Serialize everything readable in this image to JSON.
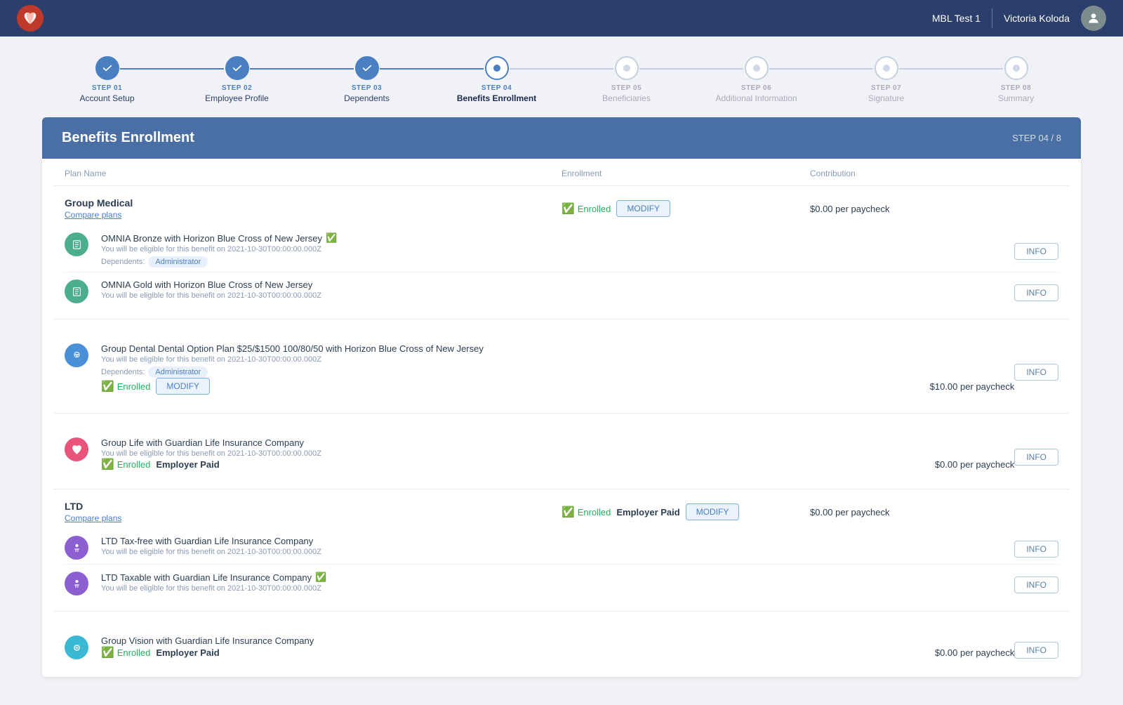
{
  "app": {
    "logo_emoji": "♥",
    "org": "MBL Test 1",
    "user": "Victoria Koloda"
  },
  "stepper": {
    "steps": [
      {
        "num": "STEP 01",
        "name": "Account Setup",
        "state": "completed"
      },
      {
        "num": "STEP 02",
        "name": "Employee Profile",
        "state": "completed"
      },
      {
        "num": "STEP 03",
        "name": "Dependents",
        "state": "completed"
      },
      {
        "num": "STEP 04",
        "name": "Benefits Enrollment",
        "state": "active"
      },
      {
        "num": "STEP 05",
        "name": "Beneficiaries",
        "state": "inactive"
      },
      {
        "num": "STEP 06",
        "name": "Additional Information",
        "state": "inactive"
      },
      {
        "num": "STEP 07",
        "name": "Signature",
        "state": "inactive"
      },
      {
        "num": "STEP 08",
        "name": "Summary",
        "state": "inactive"
      }
    ]
  },
  "section": {
    "title": "Benefits Enrollment",
    "step_label": "STEP 04 / 8"
  },
  "table": {
    "col_plan": "Plan Name",
    "col_enrollment": "Enrollment",
    "col_contribution": "Contribution"
  },
  "plans": [
    {
      "id": "group-medical",
      "name": "Group Medical",
      "compare_link": "Compare plans",
      "enrolled": true,
      "employer_paid": false,
      "show_modify": true,
      "contribution": "$0.00 per paycheck",
      "sub_plans": [
        {
          "icon_bg": "#4cae8a",
          "icon": "💊",
          "name": "OMNIA Bronze with Horizon Blue Cross of New Jersey",
          "verified": true,
          "eligibility": "You will be eligible for this benefit on 2021-10-30T00:00:00.000Z",
          "dependents_label": "Dependents:",
          "dependent_badge": "Administrator",
          "show_info": true
        },
        {
          "icon_bg": "#4cae8a",
          "icon": "💊",
          "name": "OMNIA Gold with Horizon Blue Cross of New Jersey",
          "verified": false,
          "eligibility": "You will be eligible for this benefit on 2021-10-30T00:00:00.000Z",
          "dependents_label": "",
          "dependent_badge": "",
          "show_info": true
        }
      ]
    },
    {
      "id": "group-dental",
      "name": "",
      "compare_link": "",
      "enrolled": true,
      "employer_paid": false,
      "show_modify": true,
      "contribution": "$10.00 per paycheck",
      "sub_plans": [
        {
          "icon_bg": "#4a90d9",
          "icon": "🦷",
          "name": "Group Dental Dental Option Plan $25/$1500 100/80/50 with Horizon Blue Cross of New Jersey",
          "verified": false,
          "eligibility": "You will be eligible for this benefit on 2021-10-30T00:00:00.000Z",
          "dependents_label": "Dependents:",
          "dependent_badge": "Administrator",
          "show_info": true
        }
      ]
    },
    {
      "id": "group-life",
      "name": "",
      "compare_link": "",
      "enrolled": true,
      "employer_paid": true,
      "show_modify": false,
      "contribution": "$0.00 per paycheck",
      "sub_plans": [
        {
          "icon_bg": "#e8547a",
          "icon": "♥",
          "name": "Group Life with Guardian Life Insurance Company",
          "verified": false,
          "eligibility": "You will be eligible for this benefit on 2021-10-30T00:00:00.000Z",
          "dependents_label": "",
          "dependent_badge": "",
          "show_info": true
        }
      ]
    },
    {
      "id": "ltd",
      "name": "LTD",
      "compare_link": "Compare plans",
      "enrolled": true,
      "employer_paid": true,
      "show_modify": true,
      "contribution": "$0.00 per paycheck",
      "sub_plans": [
        {
          "icon_bg": "#8b5fcf",
          "icon": "♿",
          "name": "LTD Tax-free with Guardian Life Insurance Company",
          "verified": false,
          "eligibility": "You will be eligible for this benefit on 2021-10-30T00:00:00.000Z",
          "dependents_label": "",
          "dependent_badge": "",
          "show_info": true
        },
        {
          "icon_bg": "#8b5fcf",
          "icon": "♿",
          "name": "LTD Taxable with Guardian Life Insurance Company",
          "verified": true,
          "eligibility": "You will be eligible for this benefit on 2021-10-30T00:00:00.000Z",
          "dependents_label": "",
          "dependent_badge": "",
          "show_info": true
        }
      ]
    },
    {
      "id": "group-vision",
      "name": "",
      "compare_link": "",
      "enrolled": true,
      "employer_paid": true,
      "show_modify": false,
      "contribution": "$0.00 per paycheck",
      "sub_plans": [
        {
          "icon_bg": "#3ab8d4",
          "icon": "👁",
          "name": "Group Vision with Guardian Life Insurance Company",
          "verified": false,
          "eligibility": "",
          "dependents_label": "",
          "dependent_badge": "",
          "show_info": true
        }
      ]
    }
  ],
  "labels": {
    "enrolled": "Enrolled",
    "employer_paid": "Employer Paid",
    "modify": "MODIFY",
    "info": "INFO"
  }
}
